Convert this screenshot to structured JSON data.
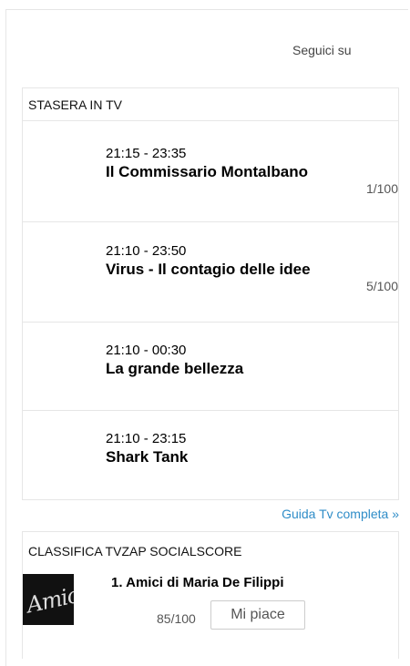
{
  "header": {
    "follow_label": "Seguici su"
  },
  "tonight": {
    "heading": "STASERA IN TV",
    "items": [
      {
        "time": "21:15 - 23:35",
        "title": "Il Commissario Montalbano",
        "score": "1/100"
      },
      {
        "time": "21:10 - 23:50",
        "title": "Virus - Il contagio delle idee",
        "score": "5/100"
      },
      {
        "time": "21:10 - 00:30",
        "title": "La grande bellezza",
        "score": ""
      },
      {
        "time": "21:10 - 23:15",
        "title": "Shark Tank",
        "score": ""
      }
    ],
    "guide_link": "Guida Tv completa »"
  },
  "ranking": {
    "heading": "CLASSIFICA TVZAP SOCIALSCORE",
    "item": {
      "thumb_text": "Amici",
      "title": "1. Amici di Maria De Filippi",
      "score": "85/100",
      "like_label": "Mi piace"
    }
  }
}
